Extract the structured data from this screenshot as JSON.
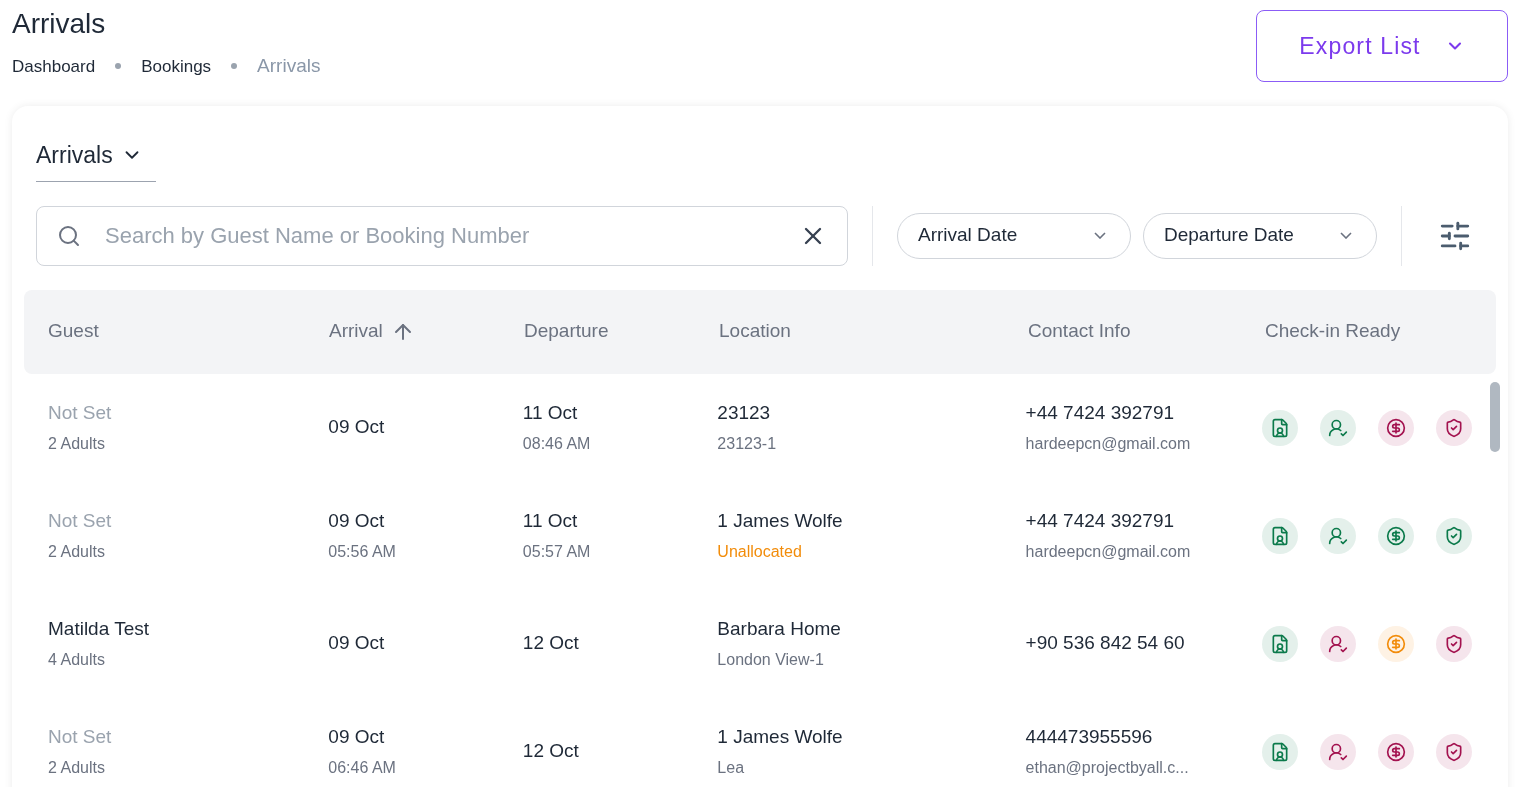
{
  "page": {
    "title": "Arrivals",
    "export_button": "Export List"
  },
  "breadcrumbs": [
    {
      "label": "Dashboard",
      "selected": false
    },
    {
      "label": "Bookings",
      "selected": false
    },
    {
      "label": "Arrivals",
      "selected": true
    }
  ],
  "view_select": {
    "label": "Arrivals"
  },
  "search": {
    "placeholder": "Search by Guest Name or Booking Number"
  },
  "filters": [
    {
      "label": "Arrival Date"
    },
    {
      "label": "Departure Date"
    }
  ],
  "table": {
    "columns": [
      {
        "label": "Guest",
        "sorted": false
      },
      {
        "label": "Arrival",
        "sorted": true
      },
      {
        "label": "Departure",
        "sorted": false
      },
      {
        "label": "Location",
        "sorted": false
      },
      {
        "label": "Contact Info",
        "sorted": false
      },
      {
        "label": "Check-in Ready",
        "sorted": false
      }
    ],
    "rows": [
      {
        "guest": "Not Set",
        "guest_set": false,
        "guests": "2 Adults",
        "arrival": "09 Oct",
        "departure": "11 Oct",
        "departure_time": "08:46 AM",
        "location": "23123",
        "unit": "23123-1",
        "unit_warning": false,
        "phone": "+44 7424 392791",
        "email": "hardeepcn@gmail.com",
        "checks": [
          {
            "kind": "document",
            "color": "#0b7a4b"
          },
          {
            "kind": "guest",
            "color": "#0b7a4b"
          },
          {
            "kind": "payment",
            "color": "#a3124f"
          },
          {
            "kind": "deposit",
            "color": "#a3124f"
          }
        ]
      },
      {
        "guest": "Not Set",
        "guest_set": false,
        "guests": "2 Adults",
        "arrival": "09 Oct",
        "arrival_time": "05:56 AM",
        "departure": "11 Oct",
        "departure_time": "05:57 AM",
        "location": "1 James Wolfe",
        "unit": "Unallocated",
        "unit_warning": true,
        "phone": "+44 7424 392791",
        "email": "hardeepcn@gmail.com",
        "checks": [
          {
            "kind": "document",
            "color": "#0b7a4b"
          },
          {
            "kind": "guest",
            "color": "#0b7a4b"
          },
          {
            "kind": "payment",
            "color": "#0b7a4b"
          },
          {
            "kind": "deposit",
            "color": "#0b7a4b"
          }
        ]
      },
      {
        "guest": "Matilda Test",
        "guest_set": true,
        "guests": "4 Adults",
        "arrival": "09 Oct",
        "departure": "12 Oct",
        "location": "Barbara Home",
        "unit": "London View-1",
        "unit_warning": false,
        "phone": "+90 536 842 54 60",
        "checks": [
          {
            "kind": "document",
            "color": "#0b7a4b"
          },
          {
            "kind": "guest",
            "color": "#a3124f"
          },
          {
            "kind": "payment",
            "color": "#f28c0a"
          },
          {
            "kind": "deposit",
            "color": "#a3124f"
          }
        ]
      },
      {
        "guest": "Not Set",
        "guest_set": false,
        "guests": "2 Adults",
        "arrival": "09 Oct",
        "arrival_time": "06:46 AM",
        "departure": "12 Oct",
        "location": "1 James Wolfe",
        "unit": "Lea",
        "unit_warning": false,
        "phone": "444473955596",
        "email": "ethan@projectbyall.c...",
        "checks": [
          {
            "kind": "document",
            "color": "#0b7a4b"
          },
          {
            "kind": "guest",
            "color": "#a3124f"
          },
          {
            "kind": "payment",
            "color": "#a3124f"
          },
          {
            "kind": "deposit",
            "color": "#a3124f"
          }
        ]
      }
    ]
  }
}
